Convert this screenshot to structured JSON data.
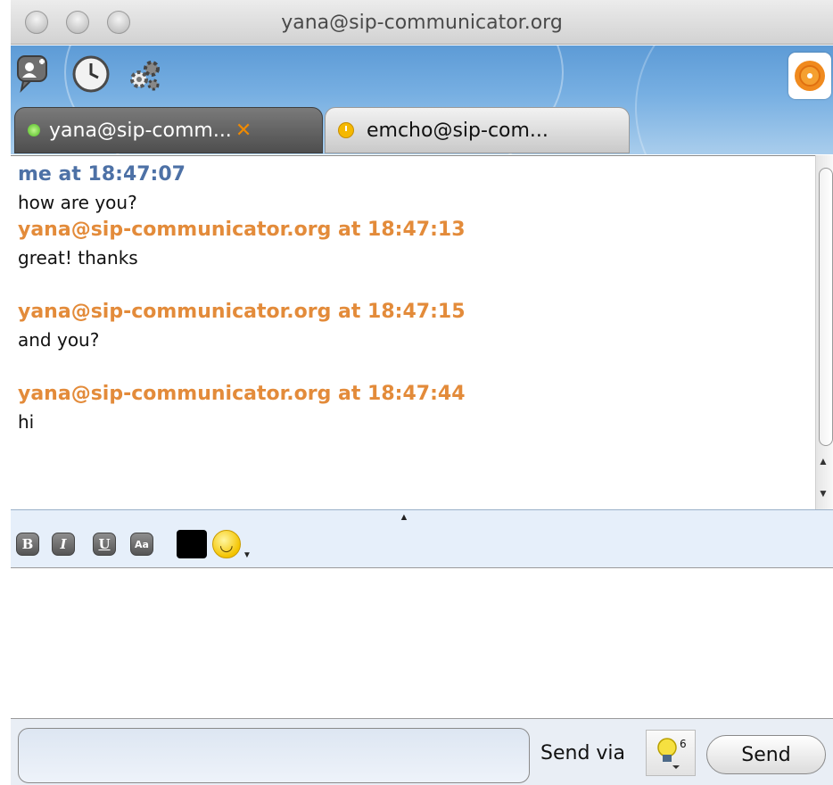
{
  "window": {
    "title": "yana@sip-communicator.org"
  },
  "tabs": [
    {
      "label": "yana@sip-comm...",
      "status": "online",
      "active": true
    },
    {
      "label": "emcho@sip-com...",
      "status": "away",
      "active": false
    }
  ],
  "messages": [
    {
      "sender": "me at 18:47:07",
      "type": "me",
      "lines": [
        "how are you?"
      ]
    },
    {
      "sender": "yana@sip-communicator.org at 18:47:13",
      "type": "other",
      "lines": [
        "great! thanks"
      ]
    },
    {
      "sender": "yana@sip-communicator.org at 18:47:15",
      "type": "other",
      "lines": [
        "and you?"
      ]
    },
    {
      "sender": "yana@sip-communicator.org at 18:47:44",
      "type": "other",
      "lines": [
        "hi"
      ]
    }
  ],
  "format_bar": {
    "bold": "B",
    "italic": "I",
    "underline": "U",
    "font": "Aa",
    "text_color": "#000000"
  },
  "bottom": {
    "send_via_label": "Send via",
    "protocol_badge": "6",
    "send_label": "Send"
  },
  "colors": {
    "me_sender": "#4d71a6",
    "other_sender": "#e38b3a",
    "toolbar_blue": "#5d9bd6"
  },
  "icons": [
    "add-contact-icon",
    "history-clock-icon",
    "settings-gears-icon",
    "contact-avatar-icon",
    "smiley-icon",
    "lightbulb-protocol-icon"
  ]
}
